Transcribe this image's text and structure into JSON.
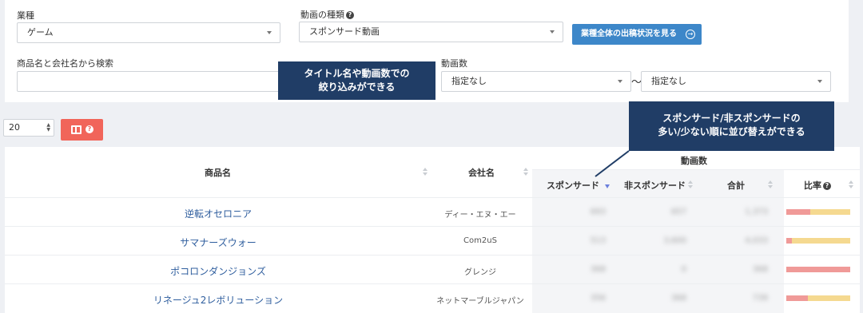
{
  "filters": {
    "industry_label": "業種",
    "industry_value": "ゲーム",
    "video_type_label": "動画の種類",
    "video_type_value": "スポンサード動画",
    "industry_overview_button": "業種全体の出稿状況を見る",
    "search_label": "商品名と会社名から検索",
    "search_value": "",
    "video_count_label": "動画数",
    "video_count_min": "指定なし",
    "video_count_max": "指定なし",
    "range_separator": "〜"
  },
  "callouts": {
    "search_hint_line1": "タイトル名や動画数での",
    "search_hint_line2": "絞り込みができる",
    "sort_hint_line1": "スポンサード/非スポンサードの",
    "sort_hint_line2": "多い/少ない順に並び替えができる"
  },
  "toolbar": {
    "page_size": "20"
  },
  "table": {
    "headers": {
      "product": "商品名",
      "company": "会社名",
      "video_count_group": "動画数",
      "sponsored": "スポンサード",
      "non_sponsored": "非スポンサード",
      "total": "合計",
      "ratio": "比率"
    },
    "rows": [
      {
        "product": "逆転オセロニア",
        "company": "ディー・エヌ・エー",
        "sponsored": "693",
        "non_sponsored": "657",
        "total": "1,373",
        "ratio_red": 0.37
      },
      {
        "product": "サマナーズウォー",
        "company": "Com2uS",
        "sponsored": "513",
        "non_sponsored": "3,600",
        "total": "4,033",
        "ratio_red": 0.09
      },
      {
        "product": "ポコロンダンジョンズ",
        "company": "グレンジ",
        "sponsored": "368",
        "non_sponsored": "0",
        "total": "368",
        "ratio_red": 1.0
      },
      {
        "product": "リネージュ2レボリューション",
        "company": "ネットマーブルジャパン",
        "sponsored": "356",
        "non_sponsored": "368",
        "total": "739",
        "ratio_red": 0.34
      }
    ]
  },
  "colors": {
    "accent_blue": "#3d87c9",
    "callout_navy": "#203d66",
    "button_red": "#f1655a",
    "sort_active": "#6b7fdc",
    "ratio_sponsored": "#f09a98",
    "ratio_non_sponsored": "#f5d990",
    "link_blue": "#2f5e9e"
  }
}
